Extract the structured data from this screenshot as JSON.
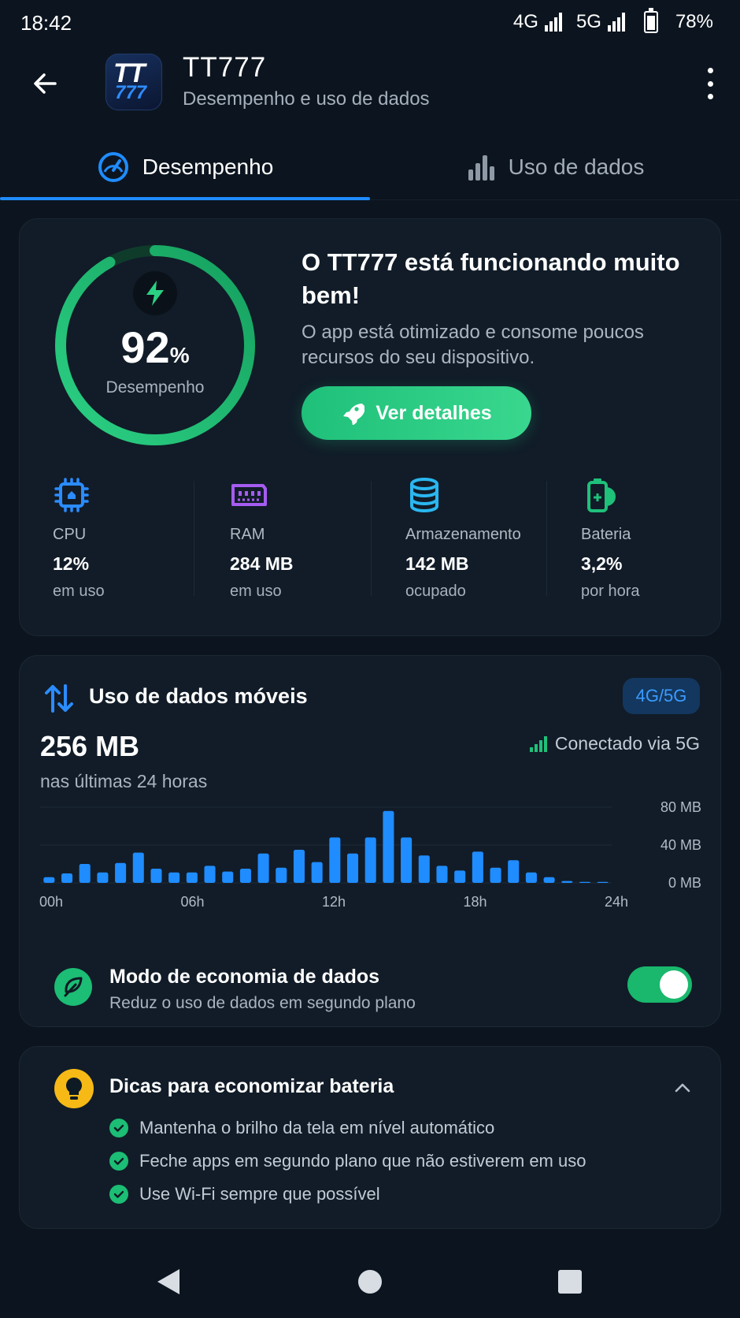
{
  "status_bar": {
    "time": "18:42",
    "net1": "4G",
    "net2": "5G",
    "battery": "78%"
  },
  "header": {
    "app_name": "TT777",
    "logo_line1": "TT",
    "logo_line2": "777",
    "subtitle": "Desempenho e uso de dados"
  },
  "tabs": [
    {
      "label": "Desempenho",
      "icon": "speedometer-icon",
      "active": true
    },
    {
      "label": "Uso de dados",
      "icon": "bar-chart-icon",
      "active": false
    }
  ],
  "performance": {
    "score": "92",
    "score_unit": "%",
    "score_fraction": 0.92,
    "score_label": "Desempenho",
    "title": "O TT777 está funcionando muito bem!",
    "description": "O app está otimizado e consome poucos recursos do seu dispositivo.",
    "button_label": "Ver detalhes",
    "metrics": [
      {
        "label": "CPU",
        "value": "12%",
        "sub": "em uso",
        "icon": "cpu-icon",
        "color": "#2b8cff"
      },
      {
        "label": "RAM",
        "value": "284 MB",
        "sub": "em uso",
        "icon": "ram-icon",
        "color": "#a55cf0"
      },
      {
        "label": "Armazenamento",
        "value": "142 MB",
        "sub": "ocupado",
        "icon": "database-icon",
        "color": "#2ab7f0"
      },
      {
        "label": "Bateria",
        "value": "3,2%",
        "sub": "por hora",
        "icon": "battery-icon",
        "color": "#1fc07a"
      }
    ]
  },
  "mobile_data": {
    "title": "Uso de dados móveis",
    "badge": "4G/5G",
    "total": "256 MB",
    "period": "nas últimas 24 horas",
    "connection": "Conectado via 5G",
    "saver_title": "Modo de economia de dados",
    "saver_sub": "Reduz o uso de dados em segundo plano",
    "saver_on": true
  },
  "chart_data": {
    "type": "bar",
    "x_tick_labels": [
      "00h",
      "06h",
      "12h",
      "18h",
      "24h"
    ],
    "y_tick_labels": [
      "80 MB",
      "40 MB",
      "0 MB"
    ],
    "ylim": [
      0,
      80
    ],
    "values": [
      6,
      10,
      20,
      11,
      21,
      32,
      15,
      11,
      11,
      18,
      12,
      15,
      31,
      16,
      35,
      22,
      48,
      31,
      48,
      76,
      48,
      29,
      18,
      13,
      33,
      16,
      24,
      11,
      6,
      2,
      1,
      1
    ],
    "color": "#1f8cff"
  },
  "tips": {
    "title": "Dicas para economizar bateria",
    "items": [
      "Mantenha o brilho da tela em nível automático",
      "Feche apps em segundo plano que não estiverem em uso",
      "Use Wi-Fi sempre que possível"
    ]
  },
  "colors": {
    "accent": "#1f8cff",
    "success": "#1fc07a",
    "background": "#0c151f",
    "card": "#111c28"
  }
}
